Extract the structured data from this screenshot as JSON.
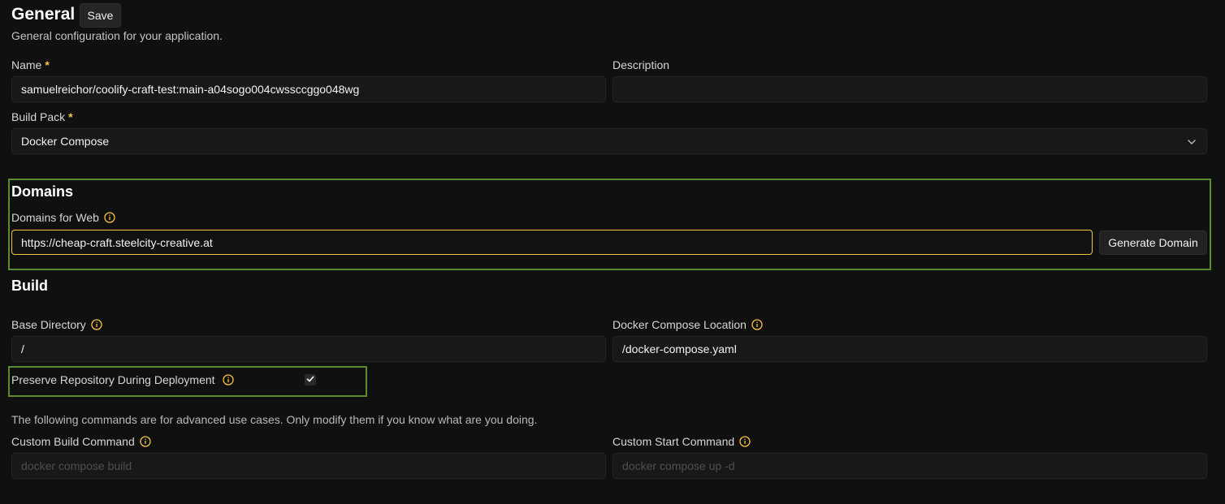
{
  "general": {
    "title": "General",
    "save_label": "Save",
    "subtitle": "General configuration for your application."
  },
  "fields": {
    "name": {
      "label": "Name",
      "required_mark": "*",
      "value": "samuelreichor/coolify-craft-test:main-a04sogo004cwssccggo048wg"
    },
    "description": {
      "label": "Description",
      "value": ""
    },
    "build_pack": {
      "label": "Build Pack",
      "required_mark": "*",
      "value": "Docker Compose"
    }
  },
  "domains": {
    "heading": "Domains",
    "domains_for_web_label": "Domains for Web",
    "domains_for_web_value": "https://cheap-craft.steelcity-creative.at",
    "generate_label": "Generate Domain"
  },
  "build": {
    "heading": "Build",
    "base_directory_label": "Base Directory",
    "base_directory_value": "/",
    "compose_location_label": "Docker Compose Location",
    "compose_location_value": "/docker-compose.yaml",
    "preserve_label": "Preserve Repository During Deployment",
    "preserve_checked": true,
    "advanced_note": "The following commands are for advanced use cases. Only modify them if you know what are you doing.",
    "custom_build_label": "Custom Build Command",
    "custom_build_placeholder": "docker compose build",
    "custom_start_label": "Custom Start Command",
    "custom_start_placeholder": "docker compose up -d"
  },
  "colors": {
    "background": "#101010",
    "accent_required": "#f5c542",
    "focus_border": "#f5c542",
    "highlight_border": "#5c8a2e"
  },
  "icons": {
    "info": "info-icon",
    "chevron": "chevron-down-icon",
    "check": "check-icon"
  }
}
